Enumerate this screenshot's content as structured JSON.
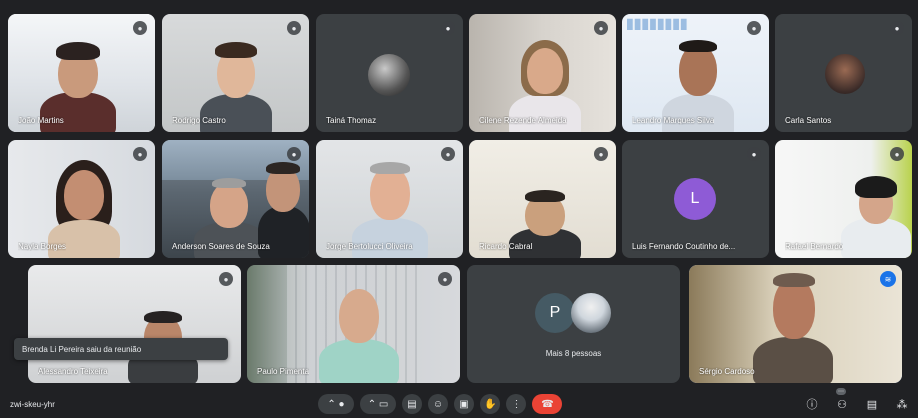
{
  "participants": [
    {
      "name": "João Martins"
    },
    {
      "name": "Rodrigo Castro"
    },
    {
      "name": "Tainá Thomaz"
    },
    {
      "name": "Cilene Rezende Almeida"
    },
    {
      "name": "Leandro Marques Silva"
    },
    {
      "name": "Carla Santos"
    },
    {
      "name": "Nayla Borges"
    },
    {
      "name": "Anderson Soares de Souza"
    },
    {
      "name": "Jorge Bertolucci Oliveira"
    },
    {
      "name": "Ricardo Cabral"
    },
    {
      "name": "Luis Fernando Coutinho de..."
    },
    {
      "name": "Rafael Bernardo"
    },
    {
      "name": "Alessandro Teixeira"
    },
    {
      "name": "Paulo Pimenta"
    },
    {
      "name": "Mais 8 pessoas"
    },
    {
      "name": "Sérgio Cardoso"
    }
  ],
  "avatar_letters": {
    "luis": "L",
    "more": "P"
  },
  "toast": "Brenda Li Pereira saiu da reunião",
  "meeting_code": "zwi-skeu-yhr",
  "colors": {
    "accent": "#1a73e8",
    "end_call": "#ea4335",
    "avatar_l": "#8e5bd6",
    "avatar_p": "#455a64"
  }
}
